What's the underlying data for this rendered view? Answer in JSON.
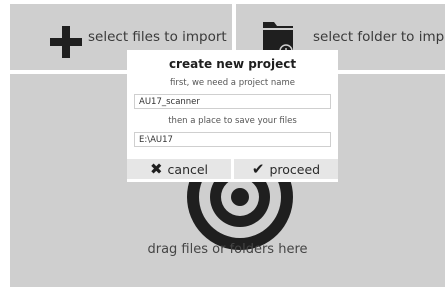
{
  "import_buttons": {
    "files_label": "select files to import",
    "folder_label": "select folder to import"
  },
  "drop_zone": {
    "label": "drag files or folders here"
  },
  "dialog": {
    "title": "create new project",
    "name_prompt": "first, we need a project name",
    "name_value": "AU17_scanner",
    "location_prompt": "then a place to save your files",
    "location_value": "E:\\AU17",
    "cancel_label": "cancel",
    "proceed_label": "proceed"
  },
  "icons": {
    "files": "plus-icon",
    "folder": "folder-icon",
    "cancel": "x-icon",
    "proceed": "checkmark-icon",
    "drop": "target-icon"
  }
}
